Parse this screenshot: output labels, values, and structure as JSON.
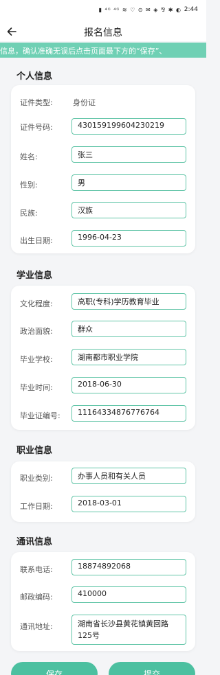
{
  "status_bar": {
    "time": "2:44",
    "icons_text": "▮ ⁴ᴳ ⁴ᴳ ≋ ♡ ⊙ ✉ ◈ ⅋ ✱ ◐"
  },
  "navbar": {
    "title": "报名信息"
  },
  "notice": {
    "text": "信息，确认准确无误后点击页面最下方的“保存”、"
  },
  "sections": {
    "personal": {
      "title": "个人信息",
      "id_type_label": "证件类型:",
      "id_type_value": "身份证",
      "id_number_label": "证件号码:",
      "id_number_value": "430159199604230219",
      "name_label": "姓名:",
      "name_value": "张三",
      "gender_label": "性别:",
      "gender_value": "男",
      "ethnicity_label": "民族:",
      "ethnicity_value": "汉族",
      "birthdate_label": "出生日期:",
      "birthdate_value": "1996-04-23"
    },
    "education": {
      "title": "学业信息",
      "level_label": "文化程度:",
      "level_value": "高职(专科)学历教育毕业",
      "political_label": "政治面貌:",
      "political_value": "群众",
      "school_label": "毕业学校:",
      "school_value": "湖南都市职业学院",
      "grad_time_label": "毕业时间:",
      "grad_time_value": "2018-06-30",
      "cert_no_label": "毕业证编号:",
      "cert_no_value": "11164334876776764"
    },
    "career": {
      "title": "职业信息",
      "category_label": "职业类别:",
      "category_value": "办事人员和有关人员",
      "work_date_label": "工作日期:",
      "work_date_value": "2018-03-01"
    },
    "contact": {
      "title": "通讯信息",
      "phone_label": "联系电话:",
      "phone_value": "18874892068",
      "postcode_label": "邮政编码:",
      "postcode_value": "410000",
      "address_label": "通讯地址:",
      "address_value": "湖南省长沙县黄花镇黄回路125号"
    }
  },
  "footer": {
    "save_label": "保存",
    "submit_label": "提交"
  },
  "colors": {
    "accent": "#5fc4a6",
    "notice_bg": "#6fd0b4",
    "button_bg": "#4cc0a0"
  }
}
